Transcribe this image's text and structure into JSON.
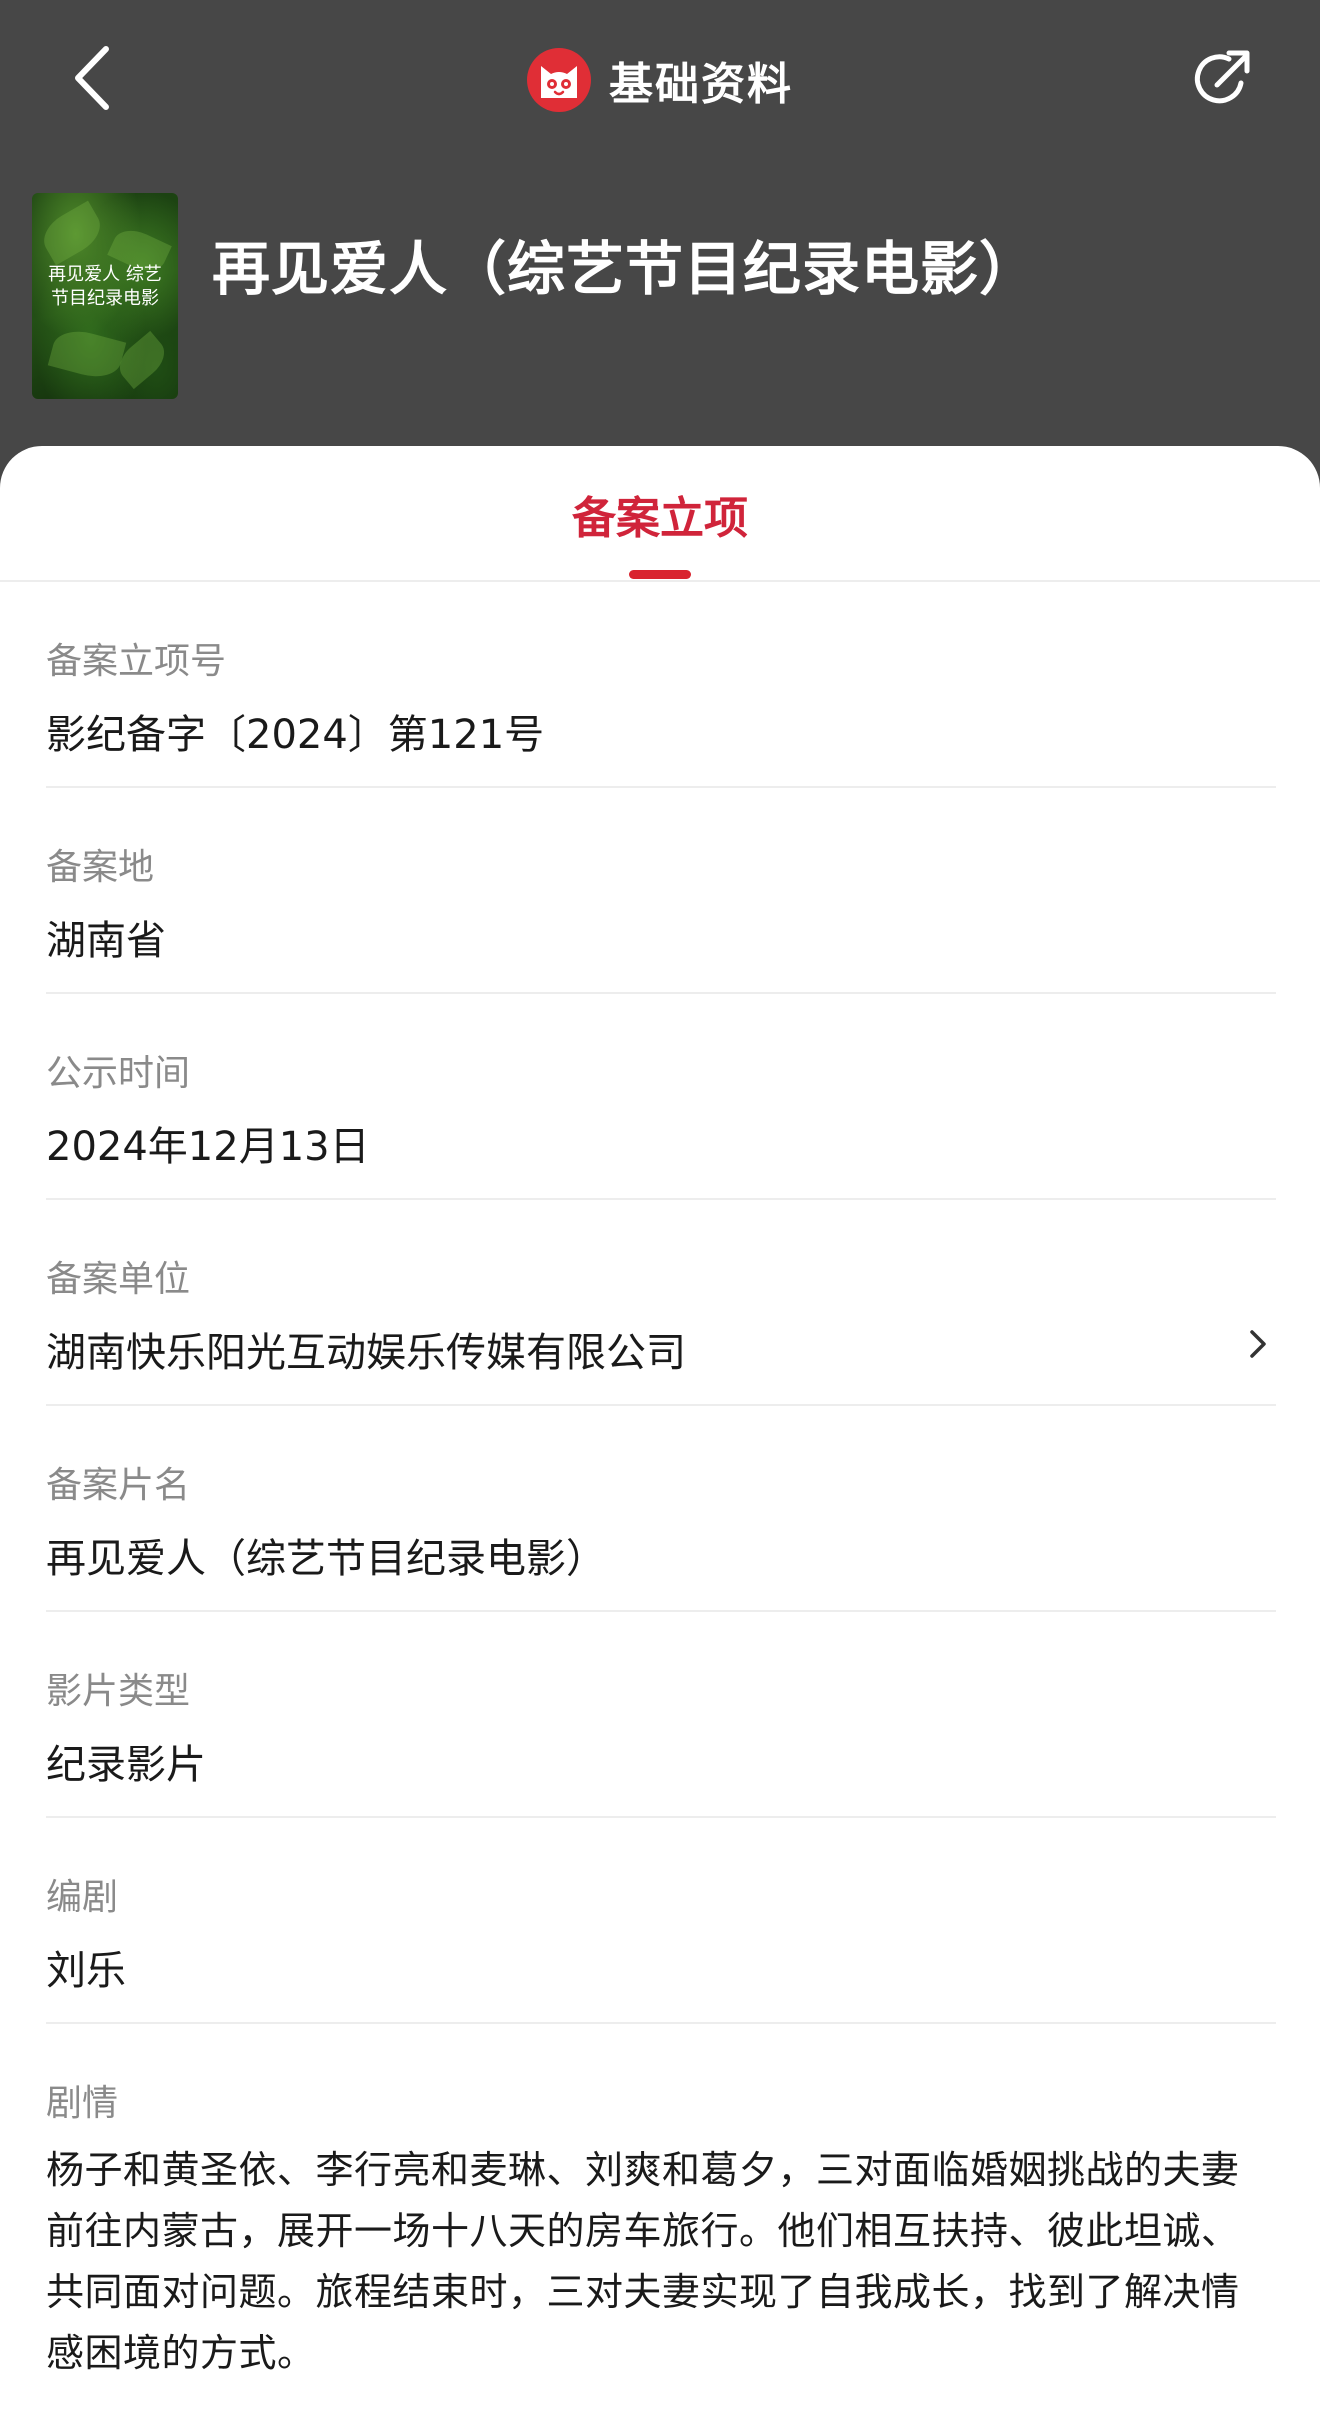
{
  "nav": {
    "title": "基础资料"
  },
  "movie": {
    "poster_text": "再见爱人 综艺节目纪录电影",
    "title": "再见爱人（综艺节目纪录电影）"
  },
  "tabs": [
    {
      "label": "备案立项",
      "active": true
    }
  ],
  "fields": [
    {
      "label": "备案立项号",
      "value": "影纪备字〔2024〕第121号"
    },
    {
      "label": "备案地",
      "value": "湖南省"
    },
    {
      "label": "公示时间",
      "value": "2024年12月13日"
    },
    {
      "label": "备案单位",
      "value": "湖南快乐阳光互动娱乐传媒有限公司"
    },
    {
      "label": "备案片名",
      "value": "再见爱人（综艺节目纪录电影）"
    },
    {
      "label": "影片类型",
      "value": "纪录影片"
    },
    {
      "label": "编剧",
      "value": "刘乐"
    }
  ],
  "plot": {
    "label": "剧情",
    "text": "杨子和黄圣依、李行亮和麦琳、刘爽和葛夕，三对面临婚姻挑战的夫妻前往内蒙古，展开一场十八天的房车旅行。他们相互扶持、彼此坦诚、共同面对问题。旅程结束时，三对夫妻实现了自我成长，找到了解决情感困境的方式。"
  },
  "colors": {
    "header_bg": "#474747",
    "accent": "#d9242f",
    "logo_red": "#e02e36",
    "label_gray": "#8a8a8a",
    "divider": "#ededed"
  },
  "icons": [
    "back-arrow-icon",
    "cat-logo-icon",
    "share-icon",
    "chevron-right-icon"
  ]
}
